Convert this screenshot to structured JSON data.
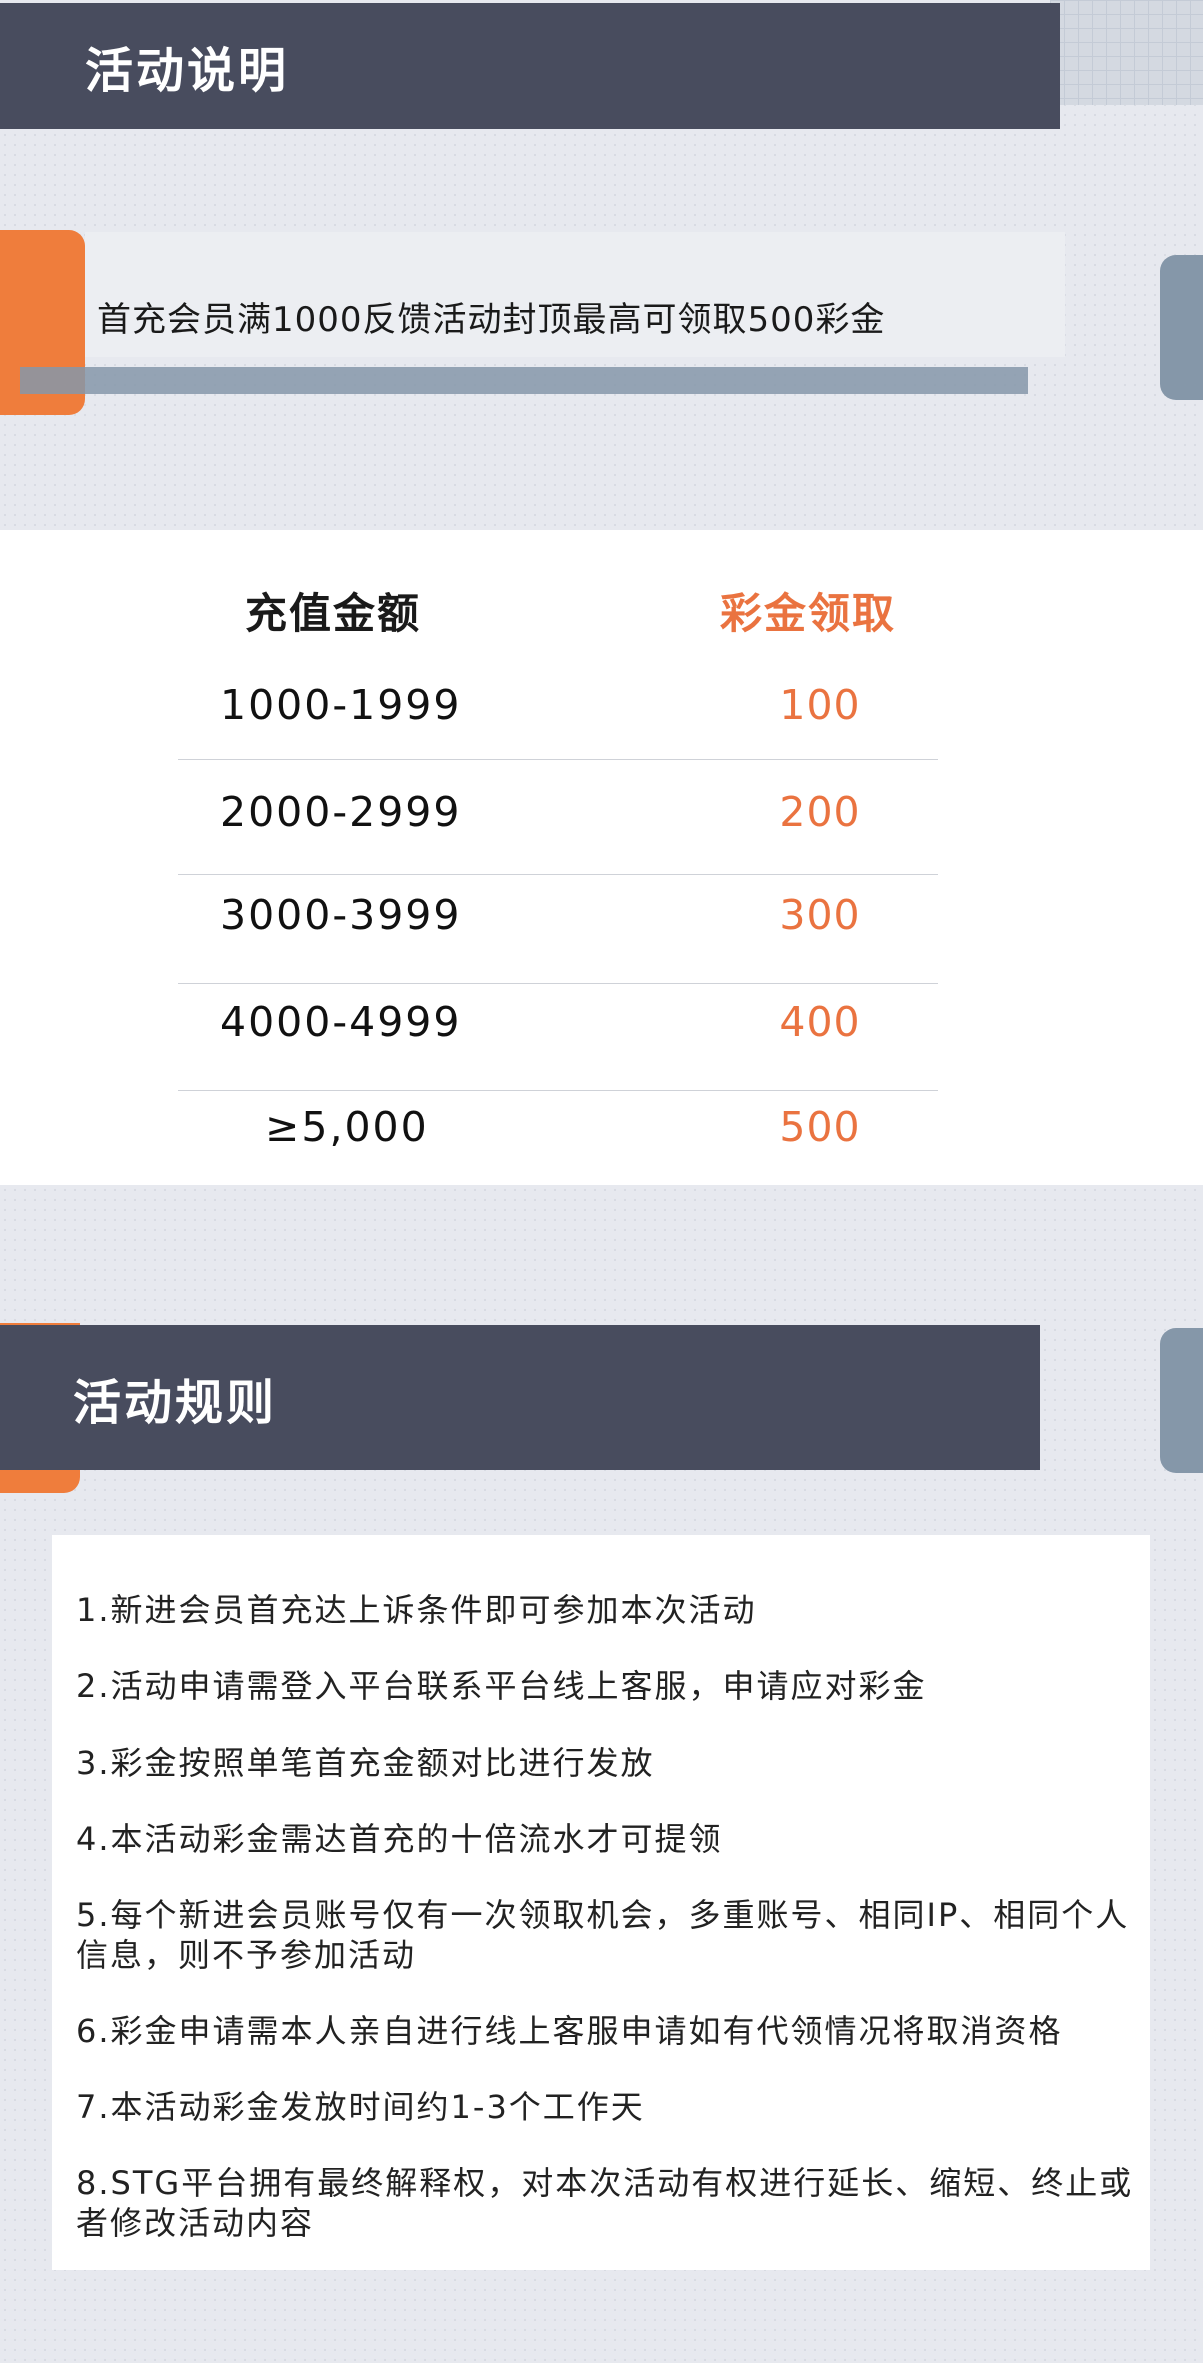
{
  "intro": {
    "header_title": "活动说明",
    "banner_text": "首充会员满1000反馈活动封顶最高可领取500彩金"
  },
  "table": {
    "col_amount": "充值金额",
    "col_bonus": "彩金领取",
    "rows": [
      {
        "amount": "1000-1999",
        "bonus": "100"
      },
      {
        "amount": "2000-2999",
        "bonus": "200"
      },
      {
        "amount": "3000-3999",
        "bonus": "300"
      },
      {
        "amount": "4000-4999",
        "bonus": "400"
      },
      {
        "amount": "≥5,000",
        "bonus": "500"
      }
    ]
  },
  "rules": {
    "header_title": "活动规则",
    "items": [
      "1.新进会员首充达上诉条件即可参加本次活动",
      "2.活动申请需登入平台联系平台线上客服，申请应对彩金",
      "3.彩金按照单笔首充金额对比进行发放",
      "4.本活动彩金需达首充的十倍流水才可提领",
      "5.每个新进会员账号仅有一次领取机会，多重账号、相同IP、相同个人信息，则不予参加活动",
      "6.彩金申请需本人亲自进行线上客服申请如有代领情况将取消资格",
      "7.本活动彩金发放时间约1-3个工作天",
      "8.STG平台拥有最终解释权，对本次活动有权进行延长、缩短、终止或者修改活动内容"
    ]
  },
  "colors": {
    "header_bg": "#484c5e",
    "accent_orange": "#ef7d3c",
    "accent_steel": "#8597a9",
    "bonus_text": "#ea7340"
  }
}
